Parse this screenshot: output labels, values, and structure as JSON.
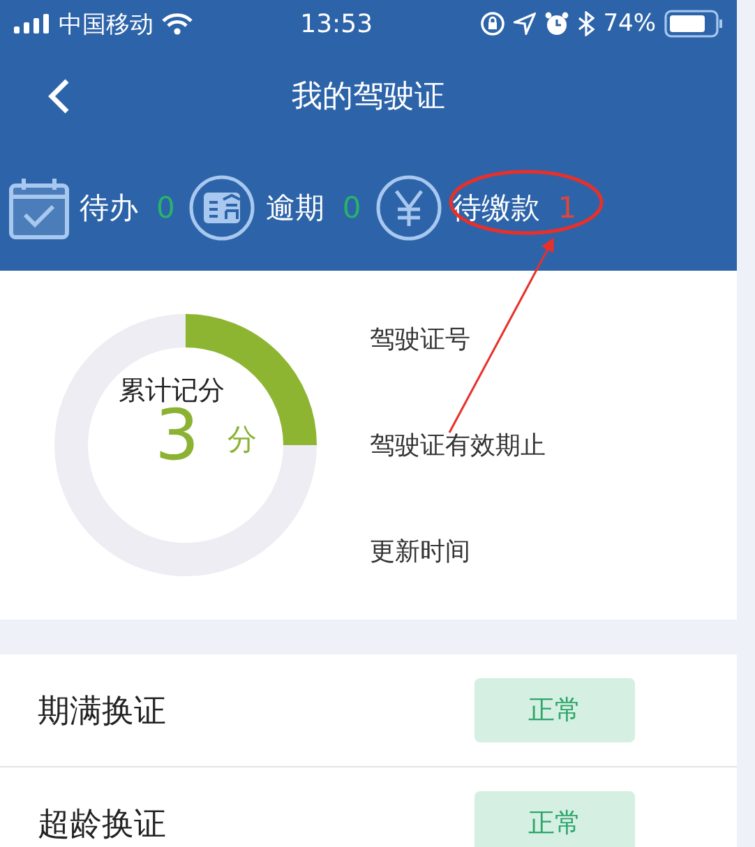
{
  "status_bar": {
    "carrier": "中国移动",
    "time": "13:53",
    "battery": "74%"
  },
  "nav": {
    "title": "我的驾驶证"
  },
  "counters": [
    {
      "kind": "todo",
      "label": "待办",
      "count": "0",
      "color": "#27b36a"
    },
    {
      "kind": "overdue",
      "label": "逾期",
      "count": "0",
      "color": "#27b36a"
    },
    {
      "kind": "payment",
      "label": "待缴款",
      "count": "1",
      "color": "#e0453a"
    }
  ],
  "score": {
    "label": "累计记分",
    "value": "3",
    "unit": "分",
    "level": 0.25
  },
  "license_fields": [
    "驾驶证号",
    "驾驶证有效期止",
    "更新时间"
  ],
  "renewals": [
    {
      "label": "期满换证",
      "status": "正常"
    },
    {
      "label": "超龄换证",
      "status": "正常"
    }
  ]
}
